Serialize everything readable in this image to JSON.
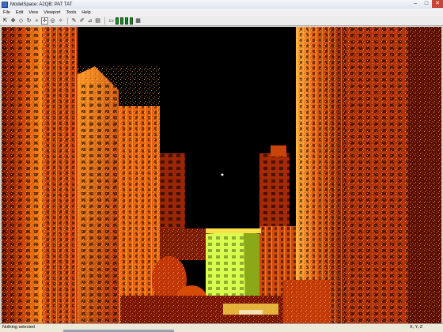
{
  "window": {
    "title": "ModelSpace: A2QB: PAT TAT",
    "buttons": {
      "minimize": "–",
      "maximize": "□",
      "close": "✕"
    }
  },
  "menu": [
    "File",
    "Edit",
    "View",
    "Viewport",
    "Tools",
    "Help"
  ],
  "toolbar": {
    "icons": [
      "select-icon",
      "move-icon",
      "diamond-icon",
      "rotate-icon",
      "zoom-icon",
      "navigate-icon",
      "orbit-icon",
      "lightbulb-icon",
      "paint-icon",
      "paint-alt-icon",
      "measure-icon",
      "section-icon",
      "panel-toggle-icon",
      "layer-1-icon",
      "layer-2-icon",
      "layer-3-icon",
      "layer-4-icon",
      "clip-icon"
    ]
  },
  "viewport": {
    "content": "colored 3D point cloud of high-rise buildings",
    "palette": {
      "deep": "#7a1402",
      "mid": "#d84a08",
      "bright": "#ff9a1c",
      "highlight": "#ffe04a",
      "lime": "#d8ff4c",
      "background": "#000000"
    }
  },
  "status": {
    "message": "Nothing selected",
    "coords": "X, Y, Z"
  }
}
